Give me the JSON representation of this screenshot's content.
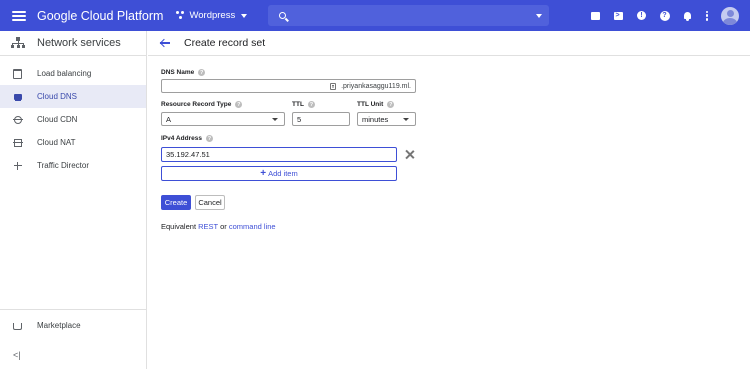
{
  "topbar": {
    "brand": "Google Cloud Platform",
    "project": "Wordpress",
    "icons": [
      "gift-icon",
      "terminal-icon",
      "support-icon",
      "help-icon",
      "bell-icon",
      "more-vert-icon"
    ]
  },
  "sidebar": {
    "title": "Network services",
    "items": [
      {
        "label": "Load balancing",
        "icon": "load-balancing-icon"
      },
      {
        "label": "Cloud DNS",
        "icon": "cloud-dns-icon",
        "active": true
      },
      {
        "label": "Cloud CDN",
        "icon": "cloud-cdn-icon"
      },
      {
        "label": "Cloud NAT",
        "icon": "cloud-nat-icon"
      },
      {
        "label": "Traffic Director",
        "icon": "traffic-director-icon"
      }
    ],
    "marketplace": "Marketplace",
    "collapse": "<|"
  },
  "page": {
    "title": "Create record set"
  },
  "form": {
    "dns_name_label": "DNS Name",
    "dns_name_value": "",
    "dns_suffix": ".priyankasaggu119.ml.",
    "record_type_label": "Resource Record Type",
    "record_type_value": "A",
    "ttl_label": "TTL",
    "ttl_value": "5",
    "ttl_unit_label": "TTL Unit",
    "ttl_unit_value": "minutes",
    "ipv4_label": "IPv4 Address",
    "ipv4_value": "35.192.47.51",
    "add_item": "Add item",
    "create": "Create",
    "cancel": "Cancel",
    "equivalent_prefix": "Equivalent",
    "rest_link": "REST",
    "or_text": "or",
    "command_line_link": "command line"
  },
  "colors": {
    "accent": "#3e4fd6",
    "active_bg": "#e8eaf6"
  }
}
